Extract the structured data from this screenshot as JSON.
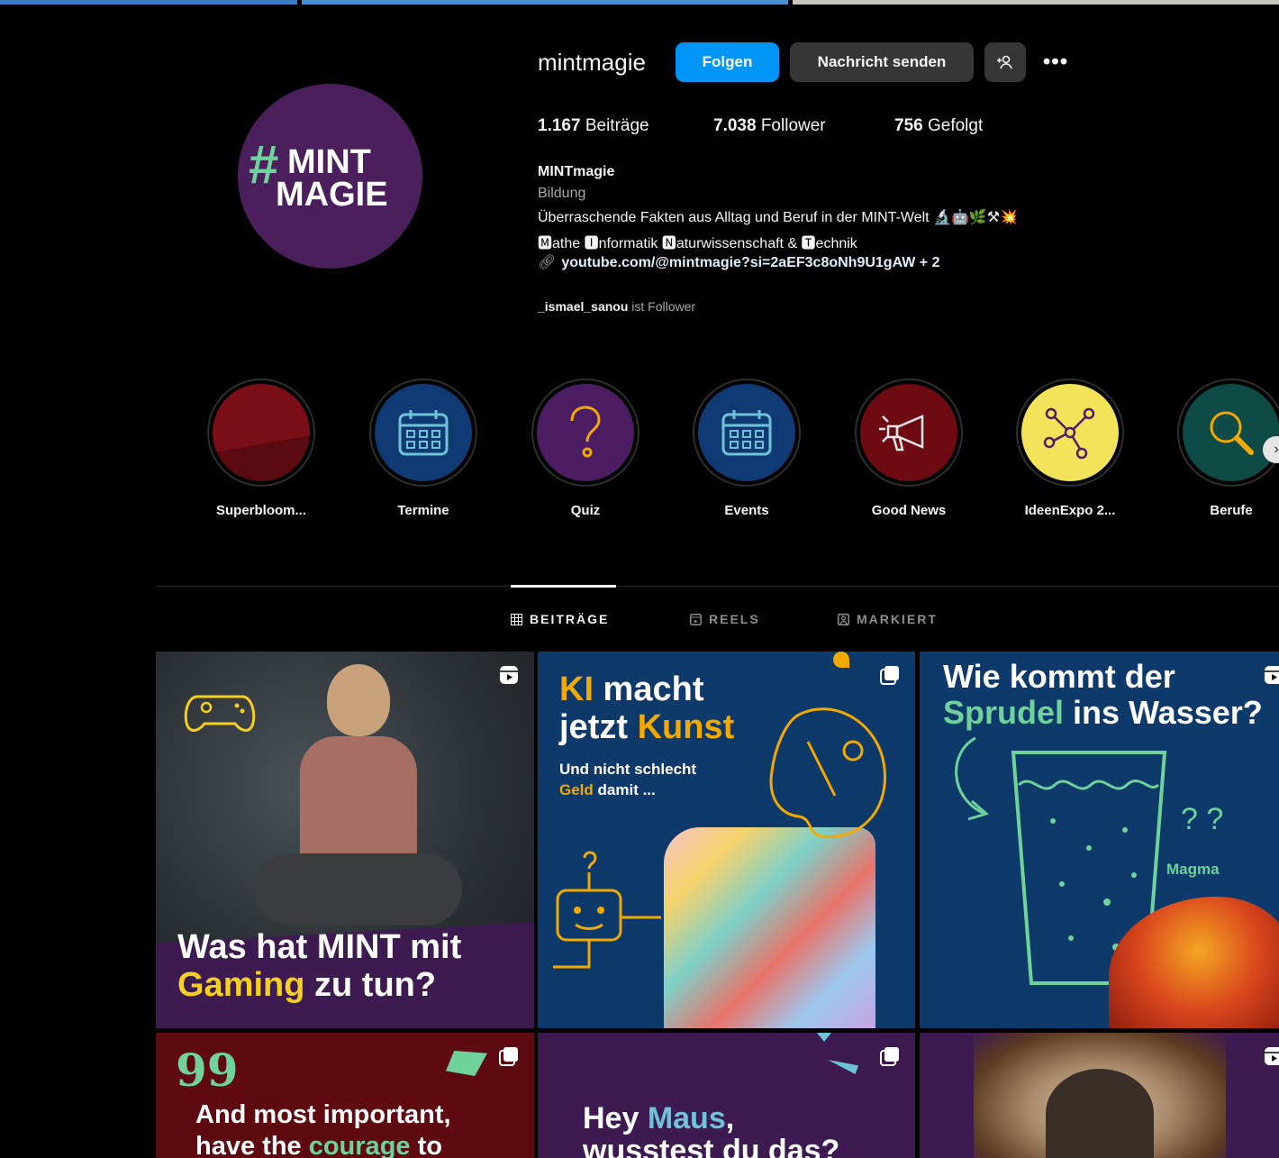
{
  "profile": {
    "username": "mintmagie",
    "avatar": {
      "hash": "#",
      "line1": "MINT",
      "line2": "MAGIE"
    },
    "follow_button": "Folgen",
    "message_button": "Nachricht senden",
    "add_user_icon": "add-user-icon",
    "more_icon": "•••",
    "stats": {
      "posts_count": "1.167",
      "posts_label": "Beiträge",
      "followers_count": "7.038",
      "followers_label": "Follower",
      "following_count": "756",
      "following_label": "Gefolgt"
    },
    "bio": {
      "name": "MINTmagie",
      "category": "Bildung",
      "line1": "Überraschende Fakten aus Alltag und Beruf in der MINT-Welt 🔬🤖🌿⚒💥",
      "line2": "🅼athe 🅸nformatik 🅽aturwissenschaft & 🆃echnik",
      "link": "youtube.com/@mintmagie?si=2aEF3c8oNh9U1gAW + 2",
      "followed_by_user": "_ismael_sanou",
      "followed_by_suffix": "ist Follower"
    }
  },
  "highlights": [
    {
      "label": "Superbloom...",
      "color": "#7a0f17"
    },
    {
      "label": "Termine",
      "color": "#0f3a74"
    },
    {
      "label": "Quiz",
      "color": "#4c1d63"
    },
    {
      "label": "Events",
      "color": "#0f3a74"
    },
    {
      "label": "Good News",
      "color": "#6e0a12"
    },
    {
      "label": "IdeenExpo 2...",
      "color": "#f2e35a"
    },
    {
      "label": "Berufe",
      "color": "#0e4a46"
    }
  ],
  "tabs": {
    "posts": "BEITRÄGE",
    "reels": "REELS",
    "tagged": "MARKIERT"
  },
  "posts": {
    "p1": {
      "l1": "Was hat MINT mit",
      "l2a": "Gaming",
      "l2b": " zu tun?"
    },
    "p2": {
      "l1a": "KI",
      "l1b": " macht",
      "l2a": "jetzt ",
      "l2b": "Kunst",
      "sub1": "Und nicht schlecht",
      "sub2a": "Geld",
      "sub2b": " damit ..."
    },
    "p3": {
      "l1": "Wie kommt der",
      "l2a": "Sprudel",
      "l2b": " ins Wasser?",
      "qq": "? ?",
      "magma": "Magma"
    },
    "p4": {
      "quote": "99",
      "l1": "And most important,",
      "l2a": "have the ",
      "l2b": "courage",
      "l2c": " to"
    },
    "p5": {
      "l1a": "Hey ",
      "l1b": "Maus",
      "l1c": ",",
      "l2": "wusstest du das?"
    }
  },
  "colors": {
    "accent": "#0095f6",
    "yellow": "#f5d020",
    "green": "#6fd29a",
    "orange": "#f2a900",
    "purple": "#3d1a50",
    "navy": "#0e3a6b"
  }
}
